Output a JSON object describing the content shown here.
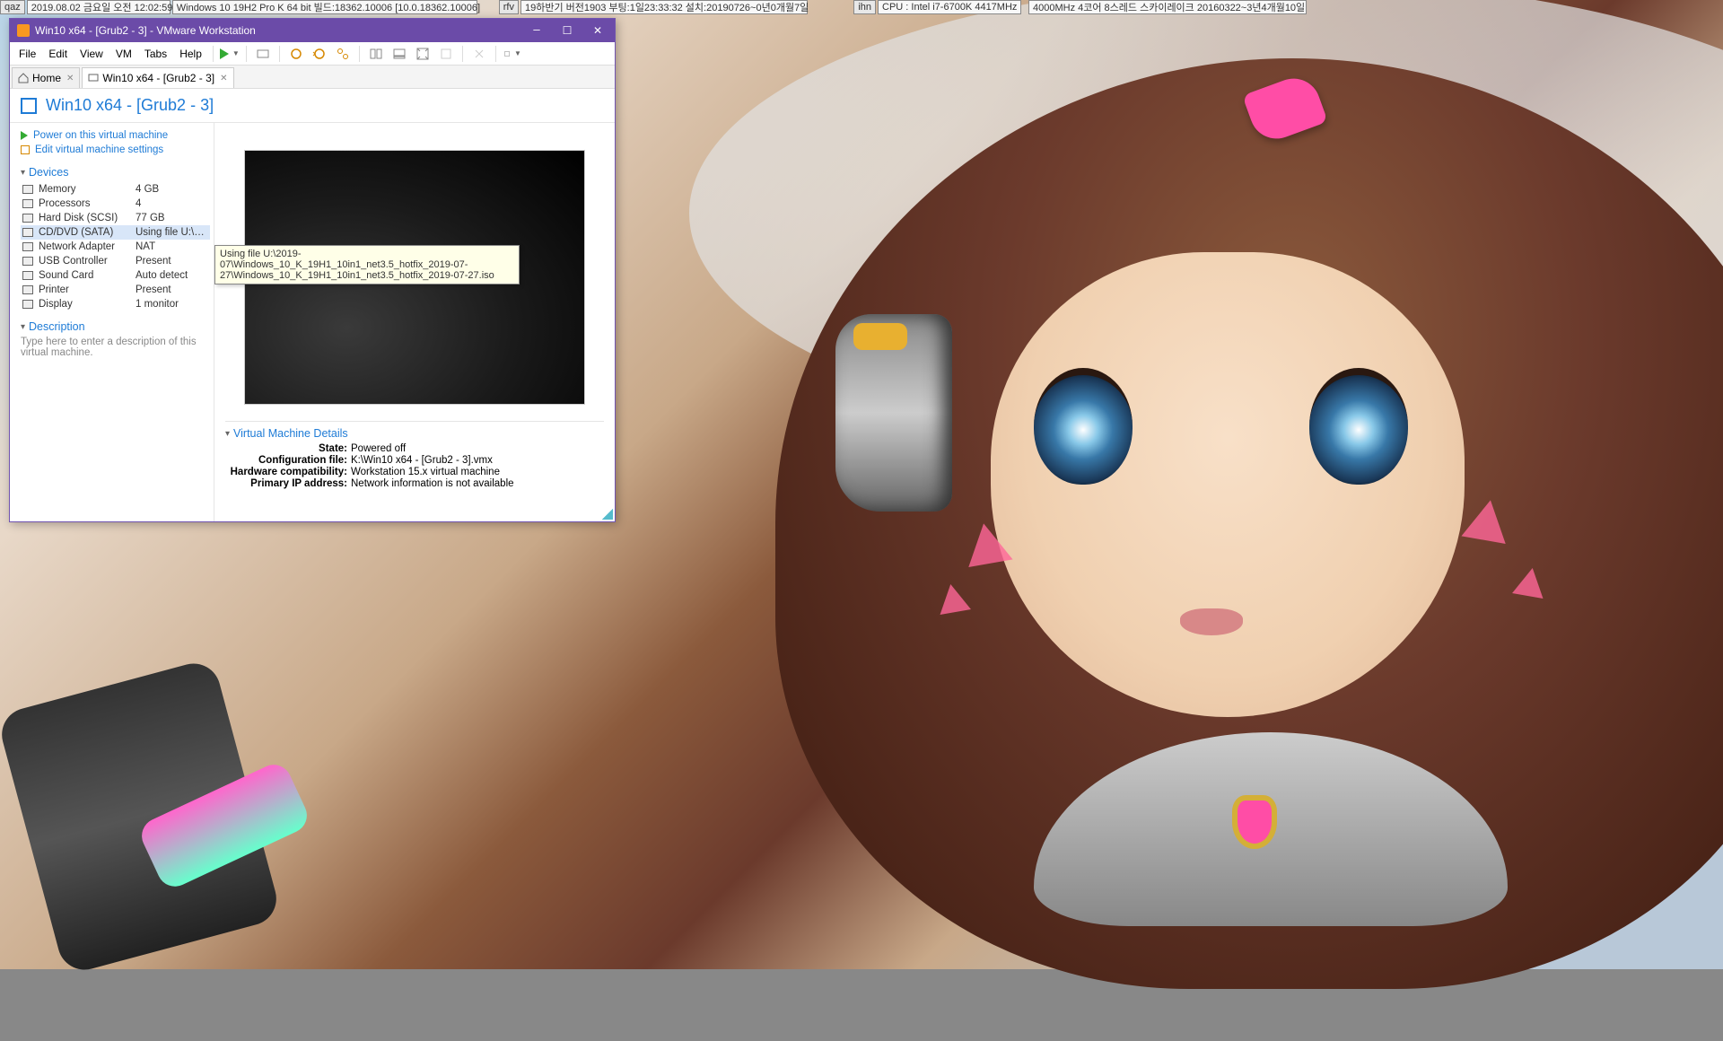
{
  "status": {
    "qaz_label": "qaz",
    "qaz_value": "2019.08.02 금요일 오전 12:02:59",
    "os_value": "Windows 10 19H2 Pro K 64 bit 빌드:18362.10006 [10.0.18362.10006]",
    "rfv_label": "rfv",
    "rfv_value": "19하반기 버전1903 부팅:1일23:33:32 설치:20190726~0년0개월7일",
    "ihn_label": "ihn",
    "ihn_value": "CPU : Intel i7-6700K 4417MHz",
    "cpu2_value": "4000MHz 4코어 8스레드 스카이레이크 20160322~3년4개월10일"
  },
  "window": {
    "title": "Win10 x64 - [Grub2 - 3] - VMware Workstation"
  },
  "menus": [
    "File",
    "Edit",
    "View",
    "VM",
    "Tabs",
    "Help"
  ],
  "tabs": {
    "home": "Home",
    "vm": "Win10 x64 - [Grub2 - 3]"
  },
  "header": {
    "vm_name": "Win10 x64 - [Grub2 - 3]"
  },
  "actions": {
    "power_on": "Power on this virtual machine",
    "edit_settings": "Edit virtual machine settings"
  },
  "sections": {
    "devices": "Devices",
    "description": "Description",
    "vmdetails": "Virtual Machine Details"
  },
  "devices": [
    {
      "name": "Memory",
      "value": "4 GB"
    },
    {
      "name": "Processors",
      "value": "4"
    },
    {
      "name": "Hard Disk (SCSI)",
      "value": "77 GB"
    },
    {
      "name": "CD/DVD (SATA)",
      "value": "Using file U:\\20..."
    },
    {
      "name": "Network Adapter",
      "value": "NAT"
    },
    {
      "name": "USB Controller",
      "value": "Present"
    },
    {
      "name": "Sound Card",
      "value": "Auto detect"
    },
    {
      "name": "Printer",
      "value": "Present"
    },
    {
      "name": "Display",
      "value": "1 monitor"
    }
  ],
  "description_placeholder": "Type here to enter a description of this virtual machine.",
  "tooltip": "Using file U:\\2019-07\\Windows_10_K_19H1_10in1_net3.5_hotfix_2019-07-27\\Windows_10_K_19H1_10in1_net3.5_hotfix_2019-07-27.iso",
  "details": {
    "state_l": "State:",
    "state_v": "Powered off",
    "cfg_l": "Configuration file:",
    "cfg_v": "K:\\Win10 x64 - [Grub2 - 3].vmx",
    "hw_l": "Hardware compatibility:",
    "hw_v": "Workstation 15.x virtual machine",
    "ip_l": "Primary IP address:",
    "ip_v": "Network information is not available"
  }
}
